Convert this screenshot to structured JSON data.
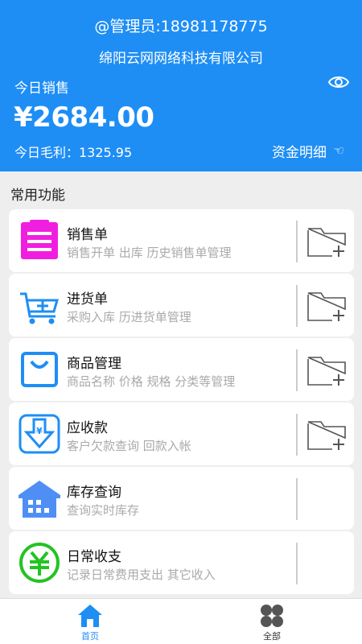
{
  "header": {
    "admin": "@管理员:18981178775",
    "company": "绵阳云网网络科技有限公司",
    "sales_label": "今日销售",
    "sales_amount": "¥2684.00",
    "profit": "今日毛利：1325.95",
    "funds_detail": "资金明细",
    "hand_glyph": "☜",
    "eye_icon": "eye-icon",
    "bg_color": "#1e8ef5"
  },
  "section_title": "常用功能",
  "cards": [
    {
      "title": "销售单",
      "desc": "销售开单 出库 历史销售单管理",
      "icon": "clipboard-icon",
      "color": "#f01fe0",
      "has_add": true
    },
    {
      "title": "进货单",
      "desc": "采购入库 历进货单管理",
      "icon": "cart-icon",
      "color": "#1e8ef5",
      "has_add": true
    },
    {
      "title": "商品管理",
      "desc": "商品名称 价格 规格 分类等管理",
      "icon": "bag-icon",
      "color": "#1e8ef5",
      "has_add": true
    },
    {
      "title": "应收款",
      "desc": "客户欠款查询 回款入帐",
      "icon": "receivable-icon",
      "color": "#1e8ef5",
      "has_add": true
    },
    {
      "title": "库存查询",
      "desc": "查询实时库存",
      "icon": "warehouse-icon",
      "color": "#4f8ff5",
      "has_add": false
    },
    {
      "title": "日常收支",
      "desc": "记录日常费用支出 其它收入",
      "icon": "yuan-circle-icon",
      "color": "#22c422",
      "has_add": false
    }
  ],
  "tabbar": {
    "home_label": "首页",
    "all_label": "全部",
    "active_color": "#1e8ef5",
    "home_icon": "home-icon",
    "all_icon": "grid-icon"
  }
}
